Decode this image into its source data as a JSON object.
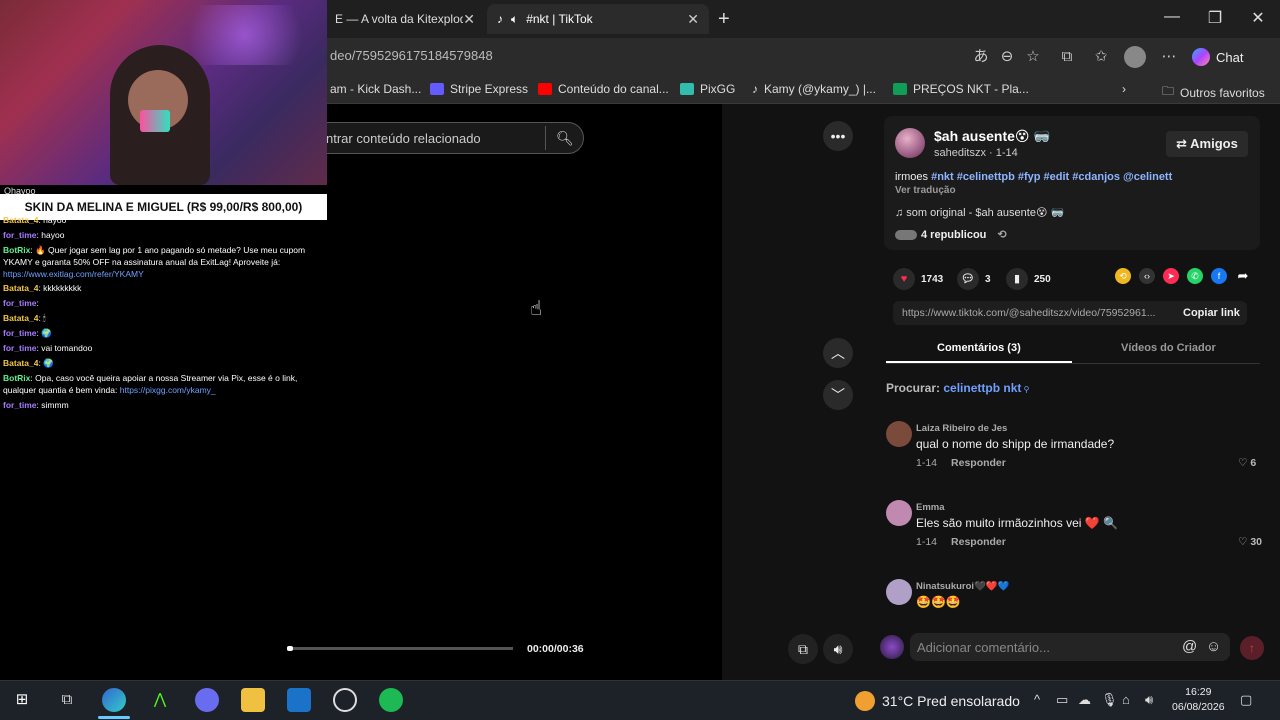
{
  "browser": {
    "tabs": [
      {
        "label": "E — A volta da Kitexplode"
      },
      {
        "label": "#nkt | TikTok"
      }
    ],
    "url": "deo/7595296175184579848",
    "chat_label": "Chat",
    "bookmarks": [
      {
        "label": "am - Kick Dash...",
        "color": "#53fc18"
      },
      {
        "label": "Stripe Express",
        "color": "#635bff"
      },
      {
        "label": "Conteúdo do canal...",
        "color": "#ff0000"
      },
      {
        "label": "PixGG",
        "color": "#32bcad"
      },
      {
        "label": "Kamy (@ykamy_) |...",
        "color": "#ffffff"
      },
      {
        "label": "PREÇOS NKT - Pla...",
        "color": "#0f9d58"
      }
    ],
    "other_favorites": "Outros favoritos"
  },
  "search": {
    "placeholder": "ntrar conteúdo relacionado"
  },
  "stream": {
    "banner_top": "Ohayoo",
    "banner": "SKIN DA MELINA E MIGUEL (R$ 99,00/R$ 800,00)",
    "chat": [
      {
        "user": "Batata_4",
        "cls": "u1",
        "text": ": hayoo"
      },
      {
        "user": "for_time",
        "cls": "u2",
        "text": ": hayoo"
      },
      {
        "user": "BotRix",
        "cls": "u3",
        "text": ": 🔥 Quer jogar sem lag por 1 ano pagando só metade? Use meu cupom YKAMY e garanta 50% OFF na assinatura anual da ExitLag! Aproveite já:",
        "link": "https://www.exitlag.com/refer/YKAMY"
      },
      {
        "user": "Batata_4",
        "cls": "u1",
        "text": ": kkkkkkkkk"
      },
      {
        "user": "for_time",
        "cls": "u2",
        "text": ":"
      },
      {
        "user": "Batata_4",
        "cls": "u1",
        "text": ": 🕯"
      },
      {
        "user": "for_time",
        "cls": "u2",
        "text": ": 🌍"
      },
      {
        "user": "for_time",
        "cls": "u2",
        "text": ": vai tomandoo"
      },
      {
        "user": "Batata_4",
        "cls": "u1",
        "text": ": 🌍"
      },
      {
        "user": "BotRix",
        "cls": "u3",
        "text": ": Opa, caso você queira apoiar a nossa Streamer via Pix, esse é o link, qualquer quantia é bem vinda:",
        "link": "https://pixgg.com/ykamy_"
      },
      {
        "user": "for_time",
        "cls": "u2",
        "text": ": simmm"
      }
    ]
  },
  "video": {
    "time": "00:00/00:36"
  },
  "post": {
    "name": "$ah ausente😵 🥽",
    "handle": "saheditszx · 1-14",
    "friends_label": "Amigos",
    "desc_prefix": "irmoes",
    "tags": "#nkt #celinettpb #fyp #edit #cdanjos @celinett",
    "translate": "Ver tradução",
    "sound": "♫  som original - $ah ausente😵 🥽",
    "reposts": "4 republicou",
    "likes": "1743",
    "comments": "3",
    "saves": "250",
    "link": "https://www.tiktok.com/@saheditszx/video/75952961...",
    "copy_link": "Copiar link"
  },
  "tabs": {
    "comments": "Comentários (3)",
    "videos": "Vídeos do Criador"
  },
  "procurar": {
    "label": "Procurar:",
    "query": "celinettpb nkt"
  },
  "comments": [
    {
      "name": "Laiza Ribeiro de Jes",
      "text": "qual o nome do shipp de irmandade?",
      "date": "1-14",
      "reply": "Responder",
      "likes": "6",
      "color": "#7a4a3a"
    },
    {
      "name": "Emma",
      "text": "Eles são muito irmãozinhos vei ❤️ 🔍",
      "date": "1-14",
      "reply": "Responder",
      "likes": "30",
      "color": "#c08ab0"
    },
    {
      "name": "Ninatsukuroi🖤❤️💙",
      "text": "🤩🤩🤩",
      "date": "1-14",
      "reply": "Responder",
      "likes": "",
      "color": "#b0a0c8"
    }
  ],
  "add_comment": {
    "placeholder": "Adicionar comentário..."
  },
  "taskbar": {
    "weather": "31°C  Pred ensolarado",
    "time": "16:29",
    "date": "06/08/2026"
  }
}
